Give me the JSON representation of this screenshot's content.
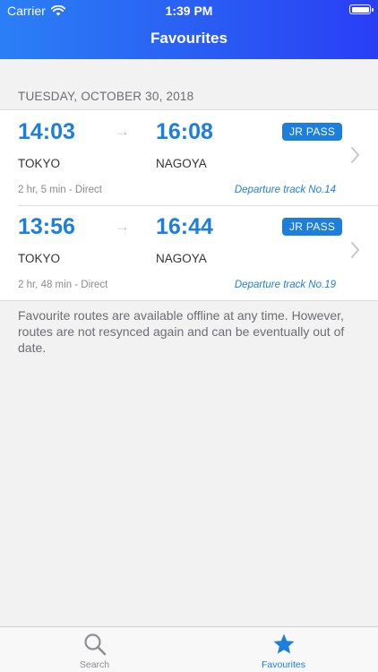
{
  "status_bar": {
    "carrier": "Carrier",
    "time": "1:39 PM"
  },
  "nav": {
    "title": "Favourites"
  },
  "date_header": "TUESDAY, OCTOBER 30, 2018",
  "routes": [
    {
      "departure_time": "14:03",
      "arrival_time": "16:08",
      "badge": "JR PASS",
      "from": "TOKYO",
      "to": "NAGOYA",
      "duration": "2 hr, 5 min - Direct",
      "track": "Departure track No.14"
    },
    {
      "departure_time": "13:56",
      "arrival_time": "16:44",
      "badge": "JR PASS",
      "from": "TOKYO",
      "to": "NAGOYA",
      "duration": "2 hr, 48 min - Direct",
      "track": "Departure track No.19"
    }
  ],
  "note": "Favourite routes are available offline at any time. However, routes are not resynced again and can be eventually out of date.",
  "tabbar": {
    "search_label": "Search",
    "favourites_label": "Favourites",
    "active_tab": "Favourites"
  },
  "colors": {
    "accent": "#1c7fdc",
    "header_gradient_start": "#2b7ff6",
    "header_gradient_end": "#2a3ef5"
  },
  "icons": {
    "signal": "wifi-icon",
    "battery": "battery-icon",
    "arrow": "arrow-right-icon",
    "chevron": "chevron-right-icon",
    "search_tab": "magnifier-icon",
    "favourites_tab": "star-icon"
  }
}
